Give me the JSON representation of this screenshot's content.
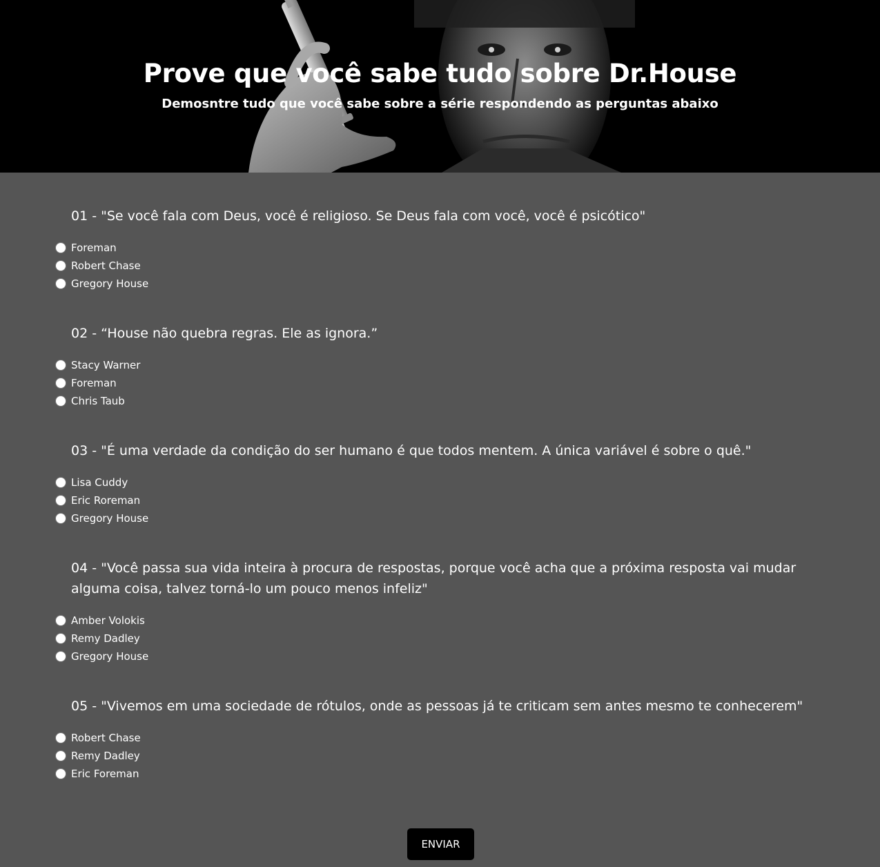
{
  "header": {
    "title": "Prove que você sabe tudo sobre Dr.House",
    "subtitle": "Demosntre tudo que você sabe sobre a série respondendo as perguntas abaixo"
  },
  "questions": [
    {
      "text": "01 - \"Se você fala com Deus, você é religioso. Se Deus fala com você, você é psicótico\"",
      "options": [
        "Foreman",
        "Robert Chase",
        "Gregory House"
      ]
    },
    {
      "text": "02 - “House não quebra regras. Ele as ignora.”",
      "options": [
        "Stacy Warner",
        "Foreman",
        "Chris Taub"
      ]
    },
    {
      "text": "03 - \"É uma verdade da condição do ser humano é que todos mentem. A única variável é sobre o quê.\"",
      "options": [
        "Lisa Cuddy",
        "Eric Roreman",
        "Gregory House"
      ]
    },
    {
      "text": "04 - \"Você passa sua vida inteira à procura de respostas, porque você acha que a próxima resposta vai mudar alguma coisa, talvez torná-lo um pouco menos infeliz\"",
      "options": [
        "Amber Volokis",
        "Remy Dadley",
        "Gregory House"
      ]
    },
    {
      "text": "05 - \"Vivemos em uma sociedade de rótulos, onde as pessoas já te criticam sem antes mesmo te conhecerem\"",
      "options": [
        "Robert Chase",
        "Remy Dadley",
        "Eric Foreman"
      ]
    }
  ],
  "form": {
    "submit_label": "ENVIAR"
  },
  "colors": {
    "page_background": "#555555",
    "header_background": "#000000",
    "button_background": "#000000",
    "text": "#ffffff"
  }
}
